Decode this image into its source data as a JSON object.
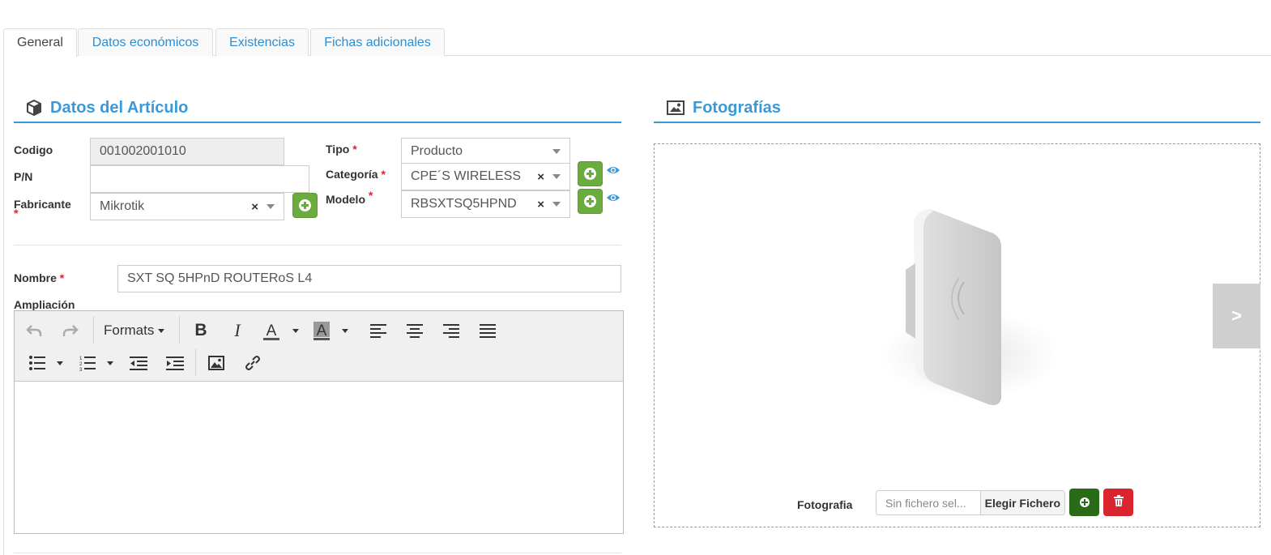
{
  "tabs": [
    {
      "label": "General",
      "active": true
    },
    {
      "label": "Datos económicos",
      "active": false
    },
    {
      "label": "Existencias",
      "active": false
    },
    {
      "label": "Fichas adicionales",
      "active": false
    }
  ],
  "article_section": {
    "title": "Datos del Artículo",
    "icon": "cube-icon",
    "codigo": {
      "label": "Codigo",
      "value": "001002001010"
    },
    "pn": {
      "label": "P/N",
      "value": ""
    },
    "fabricante": {
      "label": "Fabricante",
      "required_mark": "*",
      "value": "Mikrotik",
      "clear": "×"
    },
    "tipo": {
      "label": "Tipo",
      "required_mark": "*",
      "value": "Producto"
    },
    "categoria": {
      "label": "Categoría",
      "required_mark": "*",
      "value": "CPE´S WIRELESS",
      "clear": "×"
    },
    "modelo": {
      "label": "Modelo",
      "required_mark": "*",
      "value": "RBSXTSQ5HPND",
      "clear": "×"
    },
    "nombre": {
      "label": "Nombre",
      "required_mark": "*",
      "value": "SXT SQ 5HPnD ROUTERoS L4"
    },
    "ampliacion": {
      "label": "Ampliación"
    }
  },
  "editor": {
    "formats_label": "Formats",
    "text_color_glyph": "A",
    "bold_glyph": "B",
    "italic_glyph": "I",
    "content": ""
  },
  "photo_section": {
    "title": "Fotografías",
    "icon": "image-icon",
    "next_label": ">",
    "fotografia_label": "Fotografia",
    "file_placeholder": "Sin fichero sel...",
    "choose_file_label": "Elegir Fichero"
  },
  "colors": {
    "accent": "#3a9ad9",
    "add_green": "#6aac3d",
    "dark_green": "#2a6b18",
    "danger_red": "#d9252e"
  }
}
